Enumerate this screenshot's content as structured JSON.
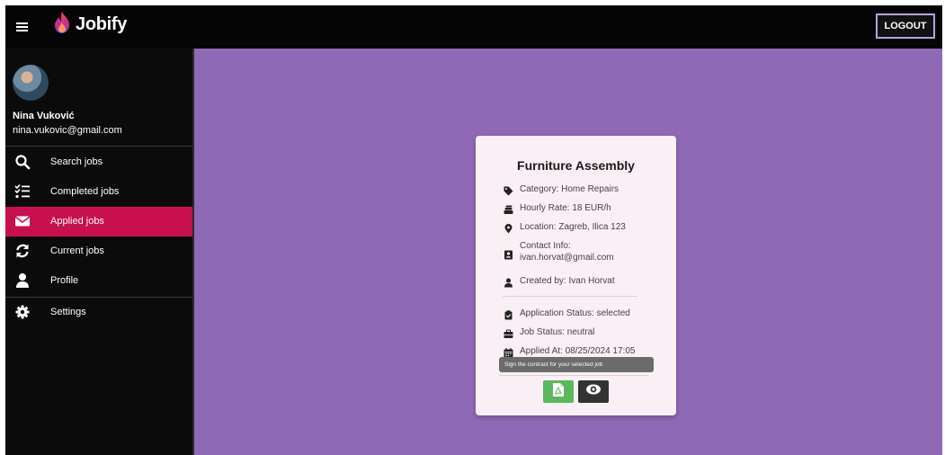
{
  "app": {
    "brand": "Jobify",
    "logout_label": "LOGOUT"
  },
  "user": {
    "name": "Nina Vuković",
    "email": "nina.vukovic@gmail.com"
  },
  "sidebar": {
    "items": [
      {
        "label": "Search jobs",
        "icon": "search-icon"
      },
      {
        "label": "Completed jobs",
        "icon": "checklist-icon"
      },
      {
        "label": "Applied jobs",
        "icon": "envelope-icon",
        "active": true
      },
      {
        "label": "Current jobs",
        "icon": "refresh-icon"
      },
      {
        "label": "Profile",
        "icon": "user-icon"
      },
      {
        "label": "Settings",
        "icon": "gear-icon"
      }
    ]
  },
  "job_card": {
    "title": "Furniture Assembly",
    "category": "Category: Home Repairs",
    "hourly_rate": "Hourly Rate: 18 EUR/h",
    "location": "Location: Zagreb, Ilica 123",
    "contact_label": "Contact Info:",
    "contact_email": "ivan.horvat@gmail.com",
    "created_by": "Created by: Ivan Horvat",
    "application_status": "Application Status: selected",
    "job_status": "Job Status: neutral",
    "applied_at": "Applied At: 08/25/2024 17:05",
    "tooltip": "Sign the contract for your selected job"
  },
  "colors": {
    "topbar": "#050505",
    "sidebar": "#0b0b0b",
    "active_item": "#c8104f",
    "content_bg": "#9069b6",
    "card_bg": "#fbeff6",
    "sign_button": "#5cb85c",
    "view_button": "#333333"
  }
}
